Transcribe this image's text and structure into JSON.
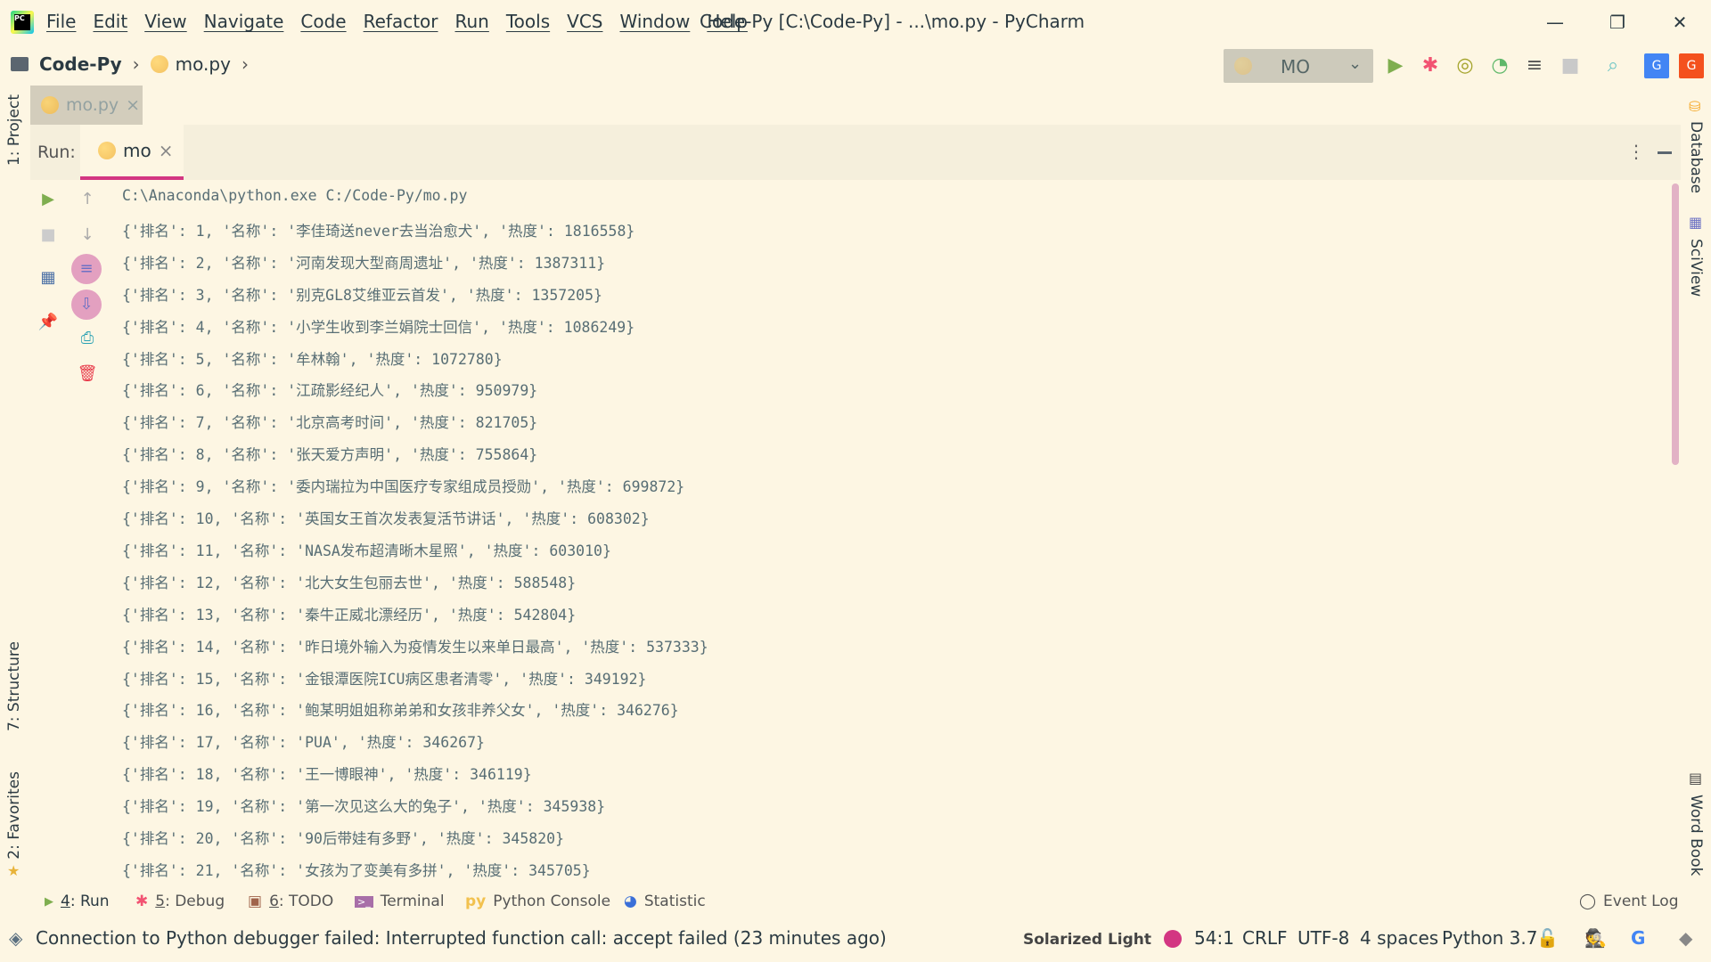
{
  "menu": [
    "File",
    "Edit",
    "View",
    "Navigate",
    "Code",
    "Refactor",
    "Run",
    "Tools",
    "VCS",
    "Window",
    "Help"
  ],
  "window_title": "Code-Py [C:\\Code-Py] - ...\\mo.py - PyCharm",
  "window_controls": {
    "minimize": "—",
    "restore": "❐",
    "close": "✕"
  },
  "breadcrumb": {
    "project": "Code-Py",
    "file": "mo.py"
  },
  "run_config": {
    "label": "MO"
  },
  "editor_tab": {
    "label": "mo.py"
  },
  "run_panel": {
    "label": "Run:",
    "tab": "mo"
  },
  "console": [
    "C:\\Anaconda\\python.exe C:/Code-Py/mo.py",
    "{'排名': 1, '名称': '李佳琦送never去当治愈犬', '热度': 1816558}",
    "{'排名': 2, '名称': '河南发现大型商周遗址', '热度': 1387311}",
    "{'排名': 3, '名称': '别克GL8艾维亚云首发', '热度': 1357205}",
    "{'排名': 4, '名称': '小学生收到李兰娟院士回信', '热度': 1086249}",
    "{'排名': 5, '名称': '牟林翰', '热度': 1072780}",
    "{'排名': 6, '名称': '江疏影经纪人', '热度': 950979}",
    "{'排名': 7, '名称': '北京高考时间', '热度': 821705}",
    "{'排名': 8, '名称': '张天爱方声明', '热度': 755864}",
    "{'排名': 9, '名称': '委内瑞拉为中国医疗专家组成员授勋', '热度': 699872}",
    "{'排名': 10, '名称': '英国女王首次发表复活节讲话', '热度': 608302}",
    "{'排名': 11, '名称': 'NASA发布超清晰木星照', '热度': 603010}",
    "{'排名': 12, '名称': '北大女生包丽去世', '热度': 588548}",
    "{'排名': 13, '名称': '秦牛正威北漂经历', '热度': 542804}",
    "{'排名': 14, '名称': '昨日境外输入为疫情发生以来单日最高', '热度': 537333}",
    "{'排名': 15, '名称': '金银潭医院ICU病区患者清零', '热度': 349192}",
    "{'排名': 16, '名称': '鲍某明姐姐称弟弟和女孩非养父女', '热度': 346276}",
    "{'排名': 17, '名称': 'PUA', '热度': 346267}",
    "{'排名': 18, '名称': '王一博眼神', '热度': 346119}",
    "{'排名': 19, '名称': '第一次见这么大的兔子', '热度': 345938}",
    "{'排名': 20, '名称': '90后带娃有多野', '热度': 345820}",
    "{'排名': 21, '名称': '女孩为了变美有多拼', '热度': 345705}"
  ],
  "left_strip": {
    "project": "1: Project",
    "structure": "7: Structure",
    "favorites": "2: Favorites"
  },
  "right_strip": {
    "database": "Database",
    "sciview": "SciView",
    "wordbook": "Word Book"
  },
  "bottom_tools": [
    {
      "num": "4",
      "label": ": Run"
    },
    {
      "num": "5",
      "label": ": Debug"
    },
    {
      "num": "6",
      "label": ": TODO"
    },
    {
      "num": "",
      "label": "Terminal"
    },
    {
      "num": "",
      "label": "Python Console"
    },
    {
      "num": "",
      "label": "Statistic"
    }
  ],
  "event_log": "Event Log",
  "status": {
    "message": "Connection to Python debugger failed: Interrupted function call: accept failed (23 minutes ago)",
    "theme": "Solarized Light",
    "position": "54:1",
    "line_sep": "CRLF",
    "encoding": "UTF-8",
    "indent": "4 spaces",
    "interpreter": "Python 3.7"
  },
  "colors": {
    "background": "#fdf6e3",
    "accent": "#d33682",
    "run_green": "#7fae4f",
    "debug_red": "#f25372"
  }
}
